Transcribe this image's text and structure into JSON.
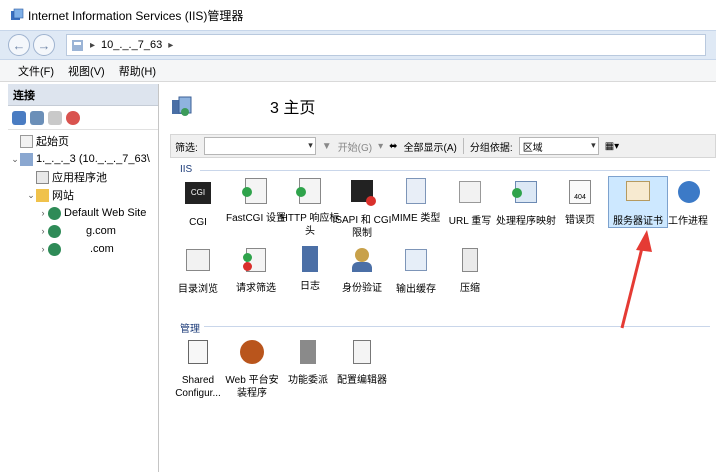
{
  "window": {
    "title": "Internet Information Services (IIS)管理器"
  },
  "nav": {
    "back": "←",
    "forward": "→",
    "breadcrumb": [
      "10_._._7_63"
    ]
  },
  "menu": [
    "文件(F)",
    "视图(V)",
    "帮助(H)"
  ],
  "connections": {
    "header": "连接",
    "tree": [
      {
        "label": "起始页",
        "level": 0
      },
      {
        "label": "1._._._3 (10._._._7_63\\",
        "level": 0
      },
      {
        "label": "应用程序池",
        "level": 1
      },
      {
        "label": "网站",
        "level": 1
      },
      {
        "label": "Default Web Site",
        "level": 2
      },
      {
        "label": "g.com",
        "level": 2
      },
      {
        "label": ".com",
        "level": 2
      }
    ]
  },
  "main": {
    "title": "3 主页",
    "filter": {
      "filter_label": "筛选:",
      "start_label": "开始(G)",
      "show_all_label": "全部显示(A)",
      "groupby_label": "分组依据:",
      "groupby_value": "区域"
    },
    "sections": [
      {
        "name": "IIS",
        "items": [
          {
            "label": "CGI",
            "icon": "cgi-icon"
          },
          {
            "label": "FastCGI 设置",
            "icon": "fastcgi-icon"
          },
          {
            "label": "HTTP 响应标头",
            "icon": "http-headers-icon"
          },
          {
            "label": "ISAPI 和 CGI 限制",
            "icon": "isapi-cgi-icon"
          },
          {
            "label": "MIME 类型",
            "icon": "mime-icon"
          },
          {
            "label": "URL 重写",
            "icon": "url-rewrite-icon"
          },
          {
            "label": "处理程序映射",
            "icon": "handler-mapping-icon"
          },
          {
            "label": "错误页",
            "icon": "error-page-icon"
          },
          {
            "label": "服务器证书",
            "icon": "server-cert-icon"
          },
          {
            "label": "工作进程",
            "icon": "worker-process-icon"
          },
          {
            "label": "目录浏览",
            "icon": "directory-browse-icon"
          },
          {
            "label": "请求筛选",
            "icon": "request-filter-icon"
          },
          {
            "label": "日志",
            "icon": "logging-icon"
          },
          {
            "label": "身份验证",
            "icon": "auth-icon"
          },
          {
            "label": "输出缓存",
            "icon": "output-cache-icon"
          },
          {
            "label": "压缩",
            "icon": "compression-icon"
          }
        ]
      },
      {
        "name": "管理",
        "items": [
          {
            "label": "Shared Configur...",
            "icon": "shared-config-icon"
          },
          {
            "label": "Web 平台安装程序",
            "icon": "web-platform-icon"
          },
          {
            "label": "功能委派",
            "icon": "feature-delegation-icon"
          },
          {
            "label": "配置编辑器",
            "icon": "config-editor-icon"
          }
        ]
      }
    ],
    "selected_item": "服务器证书"
  },
  "colors": {
    "annotation_arrow": "#e53b34",
    "selection": "#cde8ff"
  }
}
